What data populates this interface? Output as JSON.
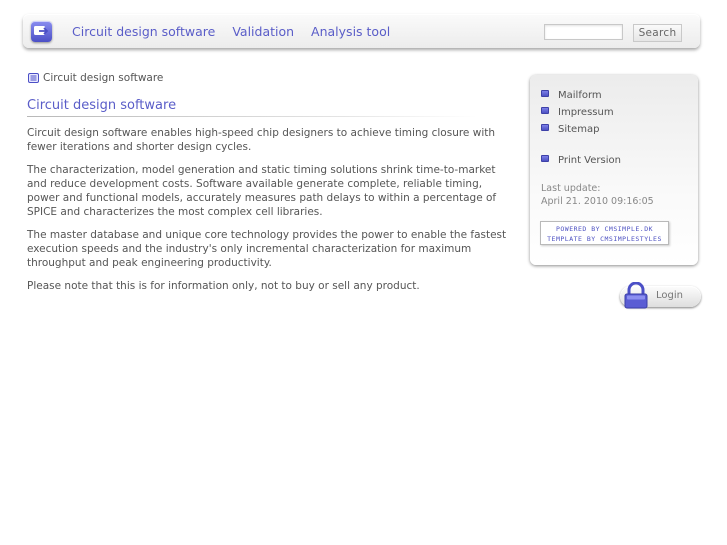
{
  "nav": {
    "items": [
      {
        "label": "Circuit design software"
      },
      {
        "label": "Validation"
      },
      {
        "label": "Analysis tool"
      }
    ]
  },
  "search": {
    "button_label": "Search",
    "value": ""
  },
  "breadcrumb": {
    "label": "Circuit design software"
  },
  "main": {
    "title": "Circuit design software",
    "paragraphs": [
      "Circuit design software enables high-speed chip designers to achieve timing closure with fewer iterations and shorter design cycles.",
      "The  characterization, model generation and static timing solutions shrink time-to-market and reduce development costs.  Software available generate complete, reliable timing, power and functional models, accurately measures path delays to within a percentage of SPICE and characterizes the most complex cell libraries.",
      "The master database and unique core technology provides the power to enable the fastest execution speeds and the industry's only incremental characterization for maximum throughput and peak engineering productivity.",
      "Please note that this is for information only, not to buy or sell any product."
    ]
  },
  "sidebar": {
    "links": [
      {
        "label": "Mailform"
      },
      {
        "label": "Impressum"
      },
      {
        "label": "Sitemap"
      }
    ],
    "print_label": "Print Version",
    "last_update_label": "Last update:",
    "last_update_value": "April 21. 2010 09:16:05",
    "badge_line1": "POWERED BY CMSIMPLE.DK",
    "badge_line2": "TEMPLATE BY CMSIMPLESTYLES"
  },
  "login": {
    "label": "Login"
  },
  "colors": {
    "accent": "#5a5dc8",
    "text": "#555555",
    "muted": "#888888"
  }
}
